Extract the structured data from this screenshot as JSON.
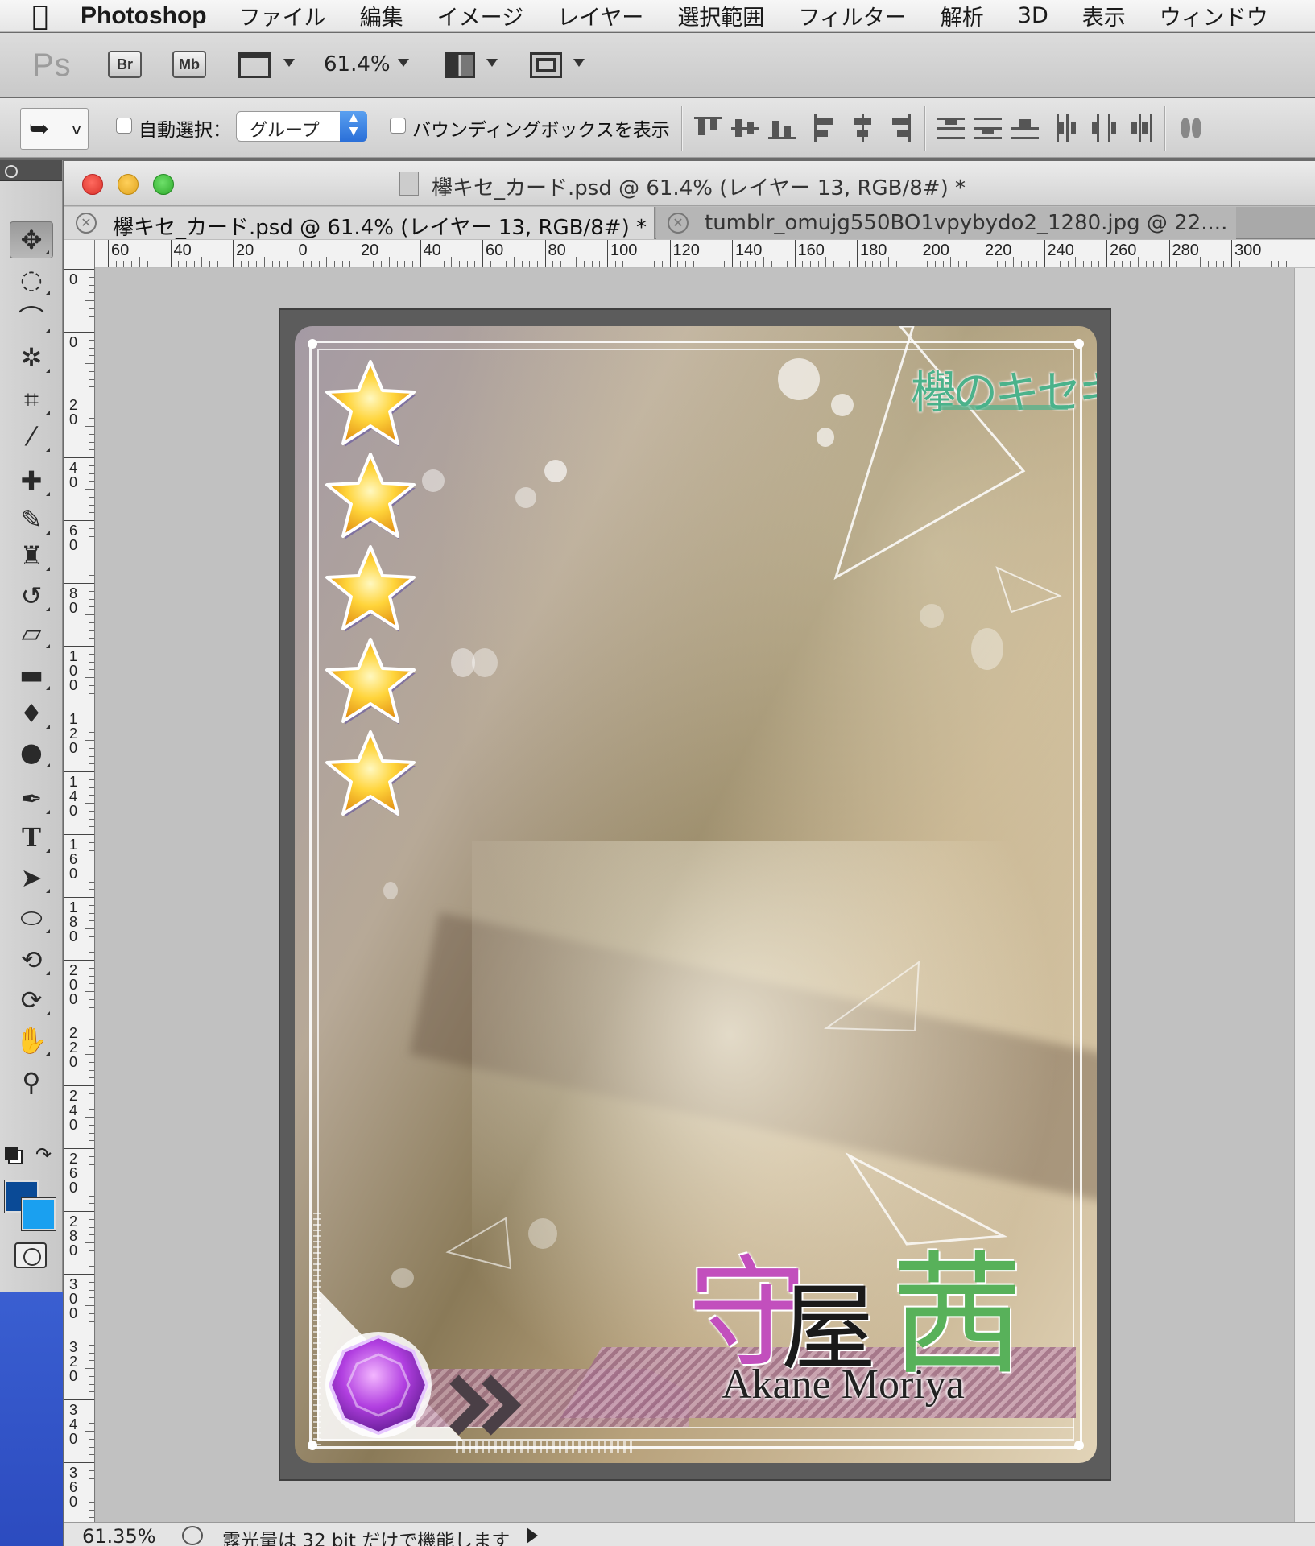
{
  "menubar": {
    "app_name": "Photoshop",
    "items": [
      "ファイル",
      "編集",
      "イメージ",
      "レイヤー",
      "選択範囲",
      "フィルター",
      "解析",
      "3D",
      "表示",
      "ウィンドウ"
    ]
  },
  "appbar": {
    "logo": "Ps",
    "bridge": "Br",
    "minibridge": "Mb",
    "zoom": "61.4%"
  },
  "options": {
    "auto_select_label": "自動選択：",
    "auto_select_value": "グループ",
    "auto_select_checked": false,
    "bounding_box_label": "バウンディングボックスを表示",
    "bounding_box_checked": false
  },
  "tools": [
    {
      "name": "move",
      "glyph": "✥",
      "active": true
    },
    {
      "name": "marquee",
      "glyph": "◌"
    },
    {
      "name": "lasso",
      "glyph": "⌒"
    },
    {
      "name": "magic-wand",
      "glyph": "✲"
    },
    {
      "name": "crop",
      "glyph": "⌗"
    },
    {
      "name": "eyedropper",
      "glyph": "⁄"
    },
    {
      "name": "healing",
      "glyph": "✚"
    },
    {
      "name": "brush",
      "glyph": "✎"
    },
    {
      "name": "stamp",
      "glyph": "♜"
    },
    {
      "name": "history-brush",
      "glyph": "↺"
    },
    {
      "name": "eraser",
      "glyph": "▱"
    },
    {
      "name": "gradient",
      "glyph": "▬"
    },
    {
      "name": "blur",
      "glyph": "♦"
    },
    {
      "name": "dodge",
      "glyph": "●"
    },
    {
      "name": "pen",
      "glyph": "✒"
    },
    {
      "name": "type",
      "glyph": "T"
    },
    {
      "name": "path-select",
      "glyph": "➤"
    },
    {
      "name": "ellipse",
      "glyph": "⬭"
    },
    {
      "name": "3d-rotate",
      "glyph": "⟲"
    },
    {
      "name": "3d-orbit",
      "glyph": "⟳"
    },
    {
      "name": "hand",
      "glyph": "✋"
    },
    {
      "name": "zoom",
      "glyph": "⚲"
    }
  ],
  "colors": {
    "foreground": "#0a4a96",
    "background": "#1aa0f0"
  },
  "document": {
    "title": "欅キセ_カード.psd @ 61.4% (レイヤー 13, RGB/8#) *",
    "tabs": [
      {
        "label": "欅キセ_カード.psd @ 61.4% (レイヤー 13, RGB/8#) *",
        "active": true
      },
      {
        "label": "tumblr_omujg550BO1vpybydo2_1280.jpg @ 22....",
        "active": false
      }
    ],
    "hruler_labels": [
      "60",
      "40",
      "20",
      "0",
      "20",
      "40",
      "60",
      "80",
      "100",
      "120",
      "140",
      "160",
      "180",
      "200",
      "220",
      "240",
      "260",
      "280",
      "300"
    ],
    "vruler_labels": [
      "0",
      "0",
      "20",
      "40",
      "60",
      "80",
      "100",
      "120",
      "140",
      "160",
      "180",
      "200",
      "220",
      "240",
      "260",
      "280",
      "300",
      "320",
      "340",
      "360"
    ]
  },
  "card": {
    "logo_text": "欅のキセキ",
    "rarity_stars": 5,
    "name_kanji": [
      "守",
      "屋",
      "茜"
    ],
    "name_romaji": "Akane Moriya",
    "kanji_colors": [
      "#c24fbd",
      "#1a1a1a",
      "#58b15a"
    ]
  },
  "status": {
    "zoom": "61.35%",
    "message": "露光量は 32 bit だけで機能します"
  }
}
